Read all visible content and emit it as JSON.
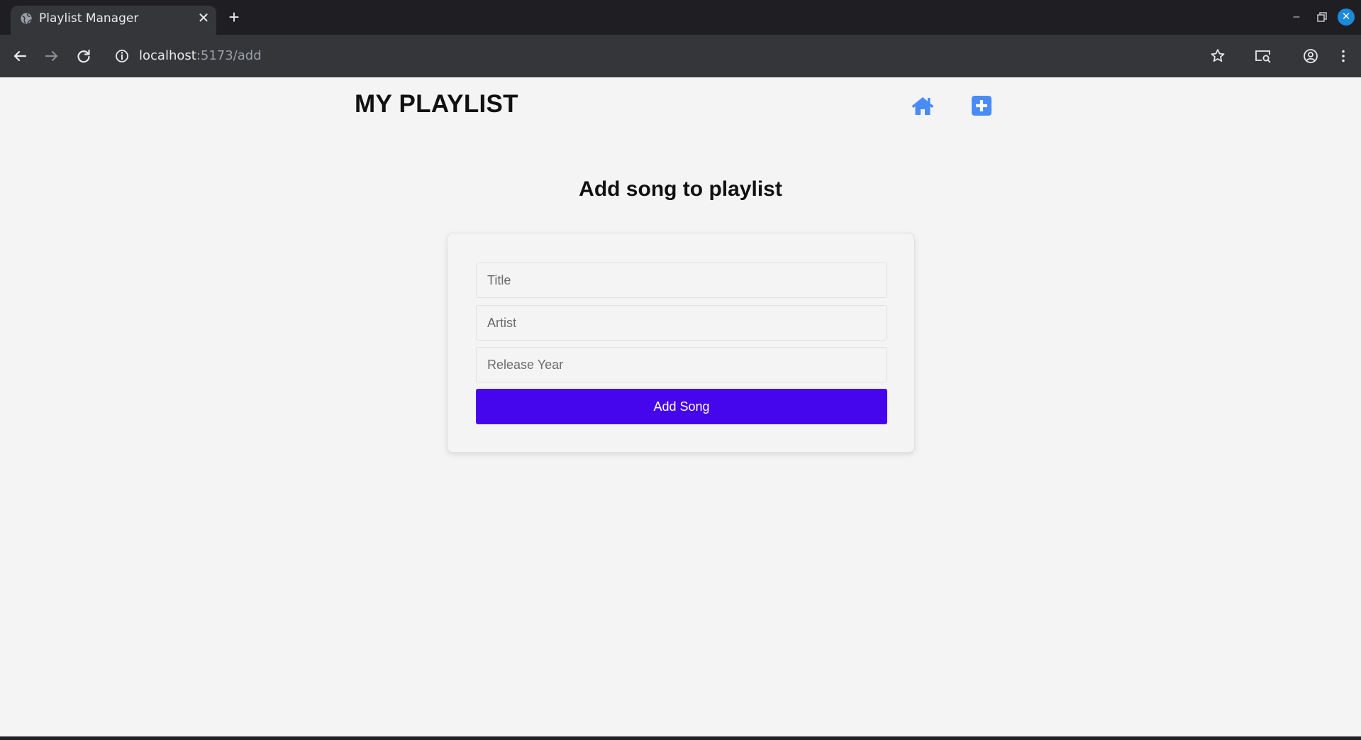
{
  "browser": {
    "tab_title": "Playlist Manager",
    "tab_close_glyph": "✕",
    "new_tab_glyph": "+",
    "url_host": "localhost",
    "url_rest": ":5173/add"
  },
  "page": {
    "brand": "MY PLAYLIST",
    "nav": {
      "home_icon": "home-icon",
      "add_icon": "plus-square-icon",
      "accent_color": "#4a8cf7"
    },
    "heading": "Add song to playlist",
    "form": {
      "title_placeholder": "Title",
      "artist_placeholder": "Artist",
      "year_placeholder": "Release Year",
      "submit_label": "Add Song",
      "submit_color": "#4506ed"
    }
  }
}
